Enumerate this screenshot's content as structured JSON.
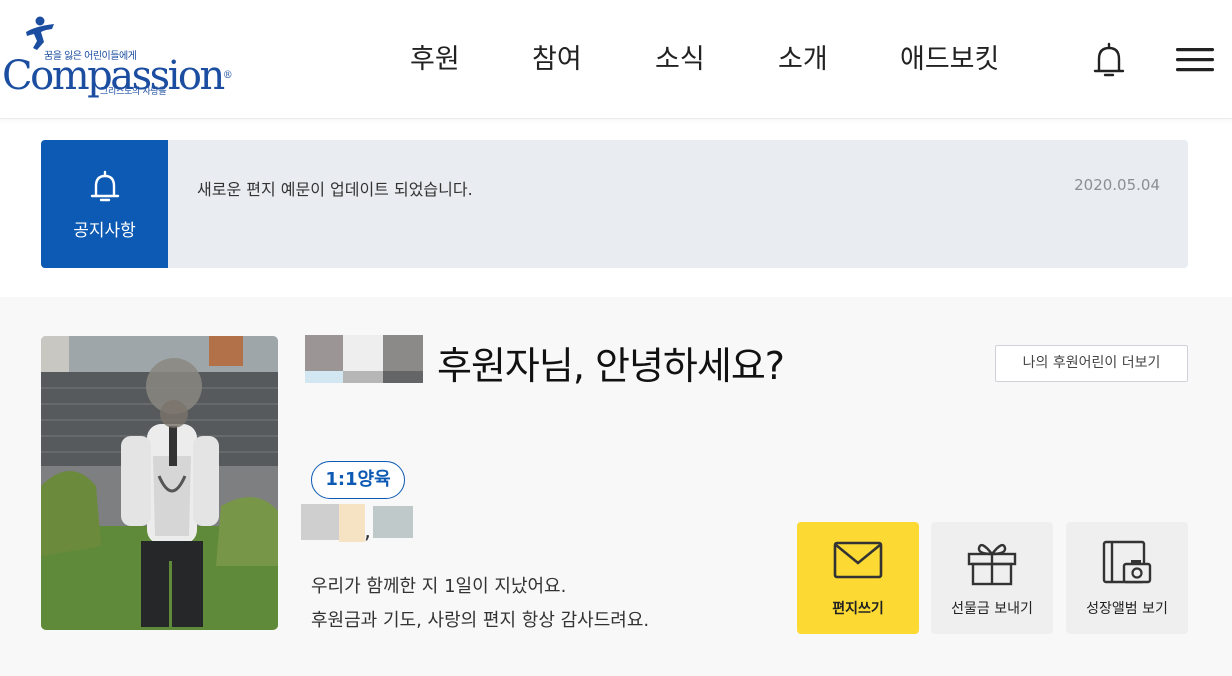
{
  "header": {
    "logo": {
      "tagline": "꿈을 잃은 어린이들에게",
      "wordmark": "Compassion",
      "registered": "®",
      "subline": "그리스도의 사랑을"
    },
    "nav": [
      "후원",
      "참여",
      "소식",
      "소개",
      "애드보킷"
    ],
    "icons": [
      "bell-icon",
      "hamburger-menu-icon"
    ]
  },
  "notice": {
    "label": "공지사항",
    "text": "새로운 편지 예문이 업데이트 되었습니다.",
    "date": "2020.05.04"
  },
  "sponsor": {
    "greeting": "후원자님, 안녕하세요?",
    "more_button": "나의 후원어린이 더보기",
    "badge": "1:1양육",
    "name_separator": ",",
    "message_line1": "우리가 함께한 지 1일이 지났어요.",
    "message_line2": "후원금과 기도, 사랑의 편지 항상 감사드려요."
  },
  "actions": [
    {
      "label": "편지쓰기",
      "icon": "envelope-icon"
    },
    {
      "label": "선물금 보내기",
      "icon": "gift-icon"
    },
    {
      "label": "성장앨범 보기",
      "icon": "album-camera-icon"
    }
  ],
  "colors": {
    "brand_blue": "#0c5ab4",
    "highlight_yellow": "#fcda33",
    "notice_bg": "#e9ecf0"
  }
}
